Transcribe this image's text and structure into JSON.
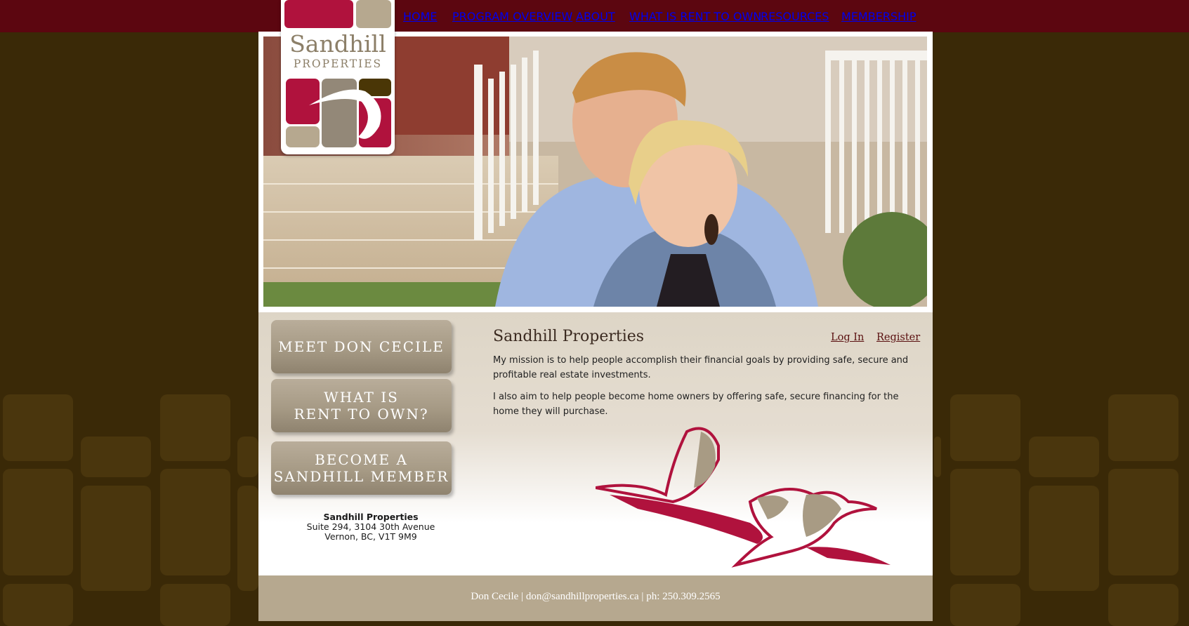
{
  "nav": {
    "items": [
      {
        "label": "HOME"
      },
      {
        "label": "PROGRAM OVERVIEW"
      },
      {
        "label": "ABOUT"
      },
      {
        "label": "WHAT IS RENT TO OWN"
      },
      {
        "label": "RESOURCES"
      },
      {
        "label": "MEMBERSHIP"
      }
    ]
  },
  "logo": {
    "line1": "Sandhill",
    "line2": "PROPERTIES"
  },
  "sidebar": {
    "buttons": [
      {
        "line1": "MEET DON CECILE",
        "line2": ""
      },
      {
        "line1": "WHAT IS",
        "line2": "RENT TO OWN?"
      },
      {
        "line1": "BECOME A",
        "line2": "SANDHILL MEMBER"
      }
    ],
    "address": {
      "name": "Sandhill Properties",
      "street": "Suite 294, 3104 30th Avenue",
      "city": "Vernon, BC, V1T 9M9"
    }
  },
  "main": {
    "title": "Sandhill Properties",
    "login": "Log In",
    "register": "Register",
    "paragraphs": [
      "My mission is to help people accomplish their financial goals by providing safe, secure and profitable real estate investments.",
      "I also aim to help people become home owners by offering safe, secure financing for the home they will purchase."
    ]
  },
  "footer": {
    "name": "Don Cecile",
    "email": "don@sandhillproperties.ca",
    "phone": "ph: 250.309.2565",
    "separator": " | "
  },
  "colors": {
    "topbar": "#5c0610",
    "background": "#3a2907",
    "brand_red": "#b0123d",
    "brand_taupe": "#b6a88f"
  }
}
